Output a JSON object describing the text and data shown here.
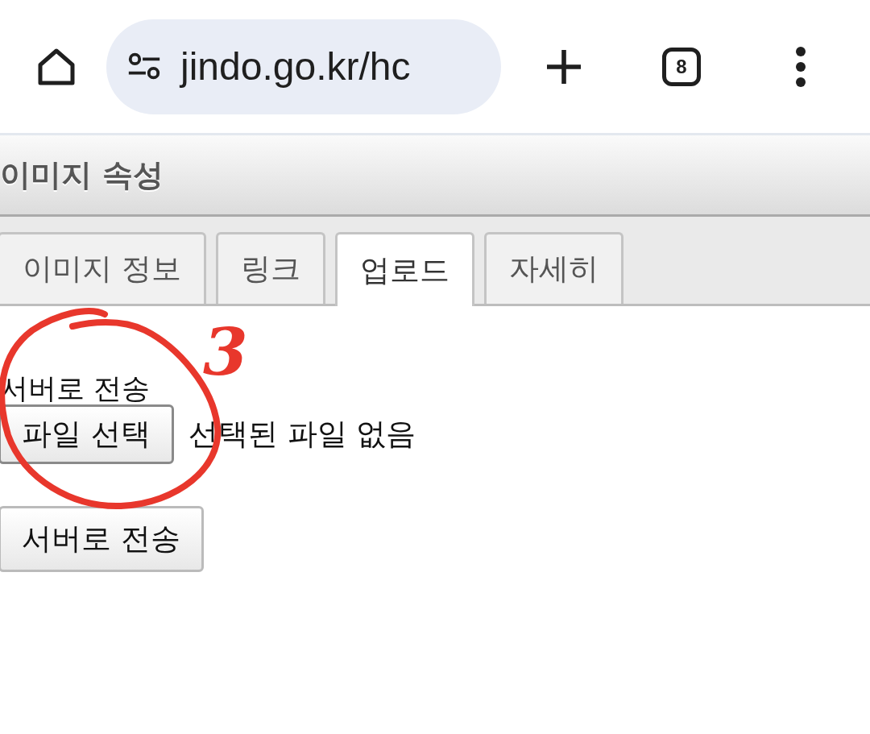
{
  "browser": {
    "url": "jindo.go.kr/hc",
    "tab_count": "8"
  },
  "dialog": {
    "title": "이미지 속성",
    "tabs": [
      {
        "label": "이미지 정보",
        "selected": false
      },
      {
        "label": "링크",
        "selected": false
      },
      {
        "label": "업로드",
        "selected": true
      },
      {
        "label": "자세히",
        "selected": false
      }
    ],
    "upload": {
      "label": "서버로 전송",
      "file_button": "파일 선택",
      "file_status": "선택된 파일 없음",
      "submit_button": "서버로 전송"
    }
  },
  "annotation": {
    "number": "3"
  }
}
